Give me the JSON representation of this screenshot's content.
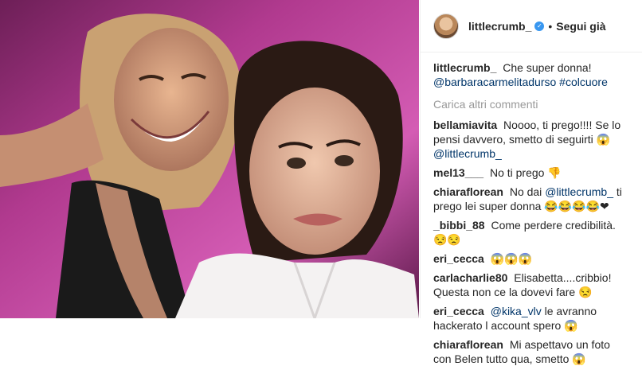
{
  "post": {
    "username": "littlecrumb_",
    "follow_label": "Segui già",
    "dot": "•",
    "verified_mark": "✓"
  },
  "caption": {
    "username": "littlecrumb_",
    "text": "Che super donna!",
    "mention": "@barbaracarmelitadurso",
    "hashtag": "#colcuore"
  },
  "load_more": "Carica altri commenti",
  "comments": [
    {
      "user": "bellamiavita",
      "pre": "Noooo, ti prego!!!! Se lo pensi davvero, smetto di seguirti 😱",
      "mention": "@littlecrumb_",
      "post": ""
    },
    {
      "user": "mel13___",
      "pre": "No ti prego 👎",
      "mention": "",
      "post": ""
    },
    {
      "user": "chiaraflorean",
      "pre": "No dai",
      "mention": "@littlecrumb_",
      "post": "ti prego lei super donna 😂😂😂😂❤"
    },
    {
      "user": "_bibbi_88",
      "pre": "Come perdere credibilità. 😒😒",
      "mention": "",
      "post": ""
    },
    {
      "user": "eri_cecca",
      "pre": "😱😱😱",
      "mention": "",
      "post": ""
    },
    {
      "user": "carlacharlie80",
      "pre": "Elisabetta....cribbio! Questa non ce la dovevi fare 😒",
      "mention": "",
      "post": ""
    },
    {
      "user": "eri_cecca",
      "pre": "",
      "mention": "@kika_vlv",
      "post": "le avranno hackerato l account spero 😱"
    },
    {
      "user": "chiaraflorean",
      "pre": "Mi aspettavo un foto con Belen tutto qua, smetto 😱",
      "mention": "",
      "post": ""
    }
  ]
}
